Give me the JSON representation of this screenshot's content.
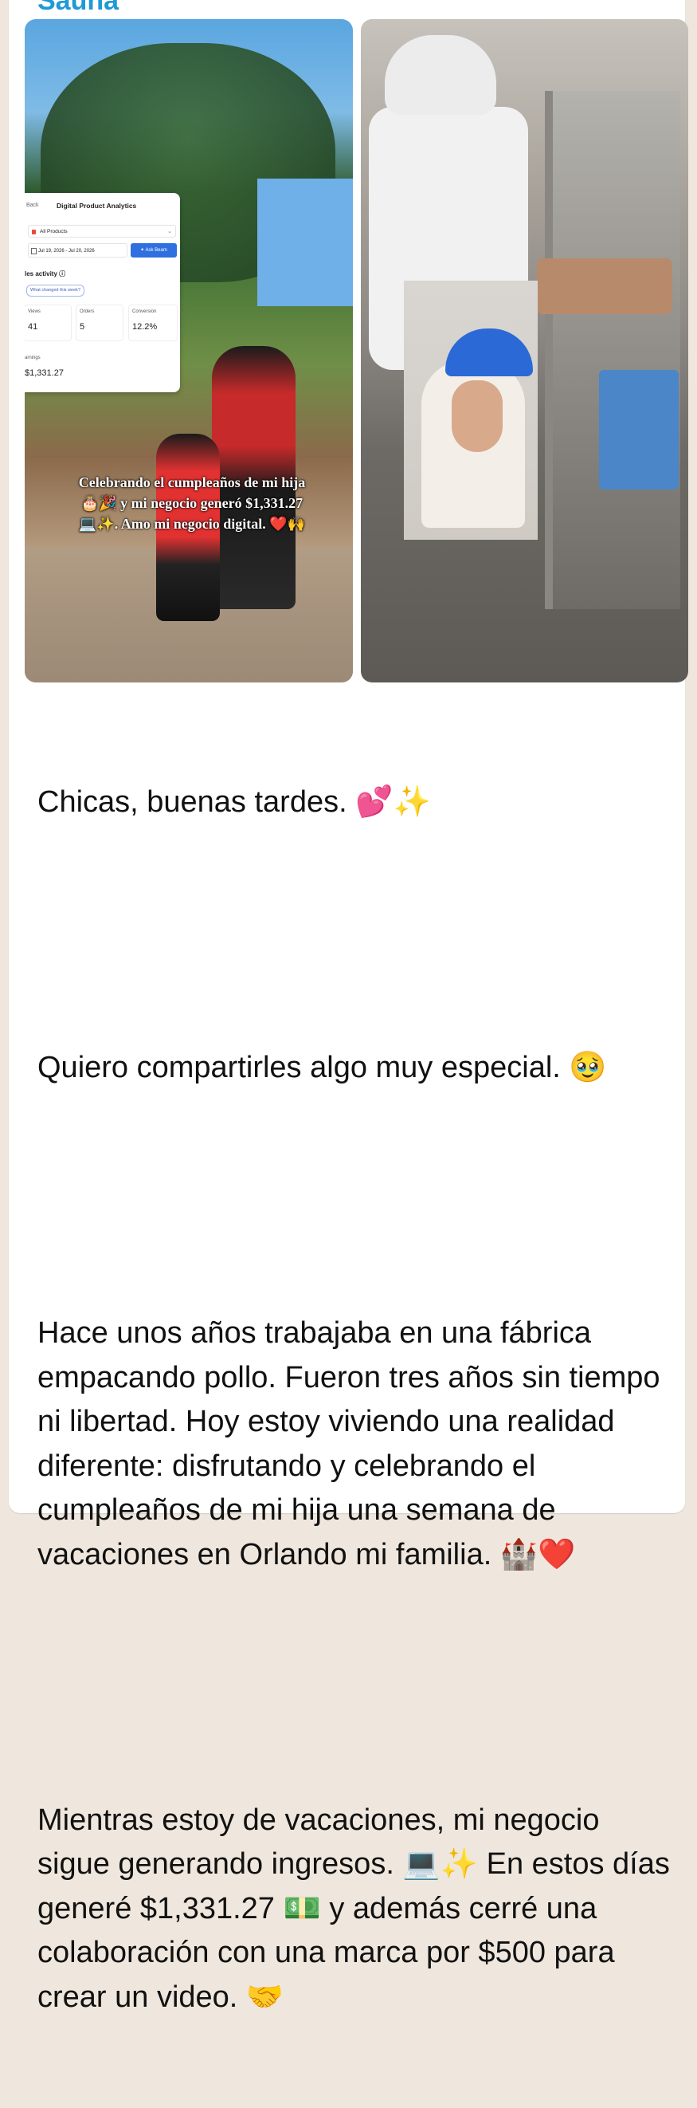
{
  "sender_name": "Sauna",
  "left_image": {
    "analytics_card": {
      "back": "Back",
      "title": "Digital Product Analytics",
      "products_filter": "All Products",
      "date_range": "Jul 19, 2026 - Jul 20, 2026",
      "ask_button": "✦ Ask Beam",
      "activity_heading": "les activity ⓘ",
      "activity_chip": "What changed this week?",
      "metrics": [
        {
          "label": "Views",
          "value": "41"
        },
        {
          "label": "Orders",
          "value": "5"
        },
        {
          "label": "Conversion",
          "value": "12.2%"
        }
      ],
      "earnings_label": "arnings",
      "earnings_value": "$1,331.27"
    },
    "caption": "Celebrando el cumpleaños de mi hija 🎂🎉 y mi negocio generó $1,331.27 💻✨. Amo mi negocio digital. ❤️🙌"
  },
  "message_paragraphs": [
    "Chicas, buenas tardes. 💕✨",
    "Quiero compartirles algo muy especial. 🥹",
    "Hace unos años trabajaba en una fábrica empacando pollo. Fueron tres años sin tiempo ni libertad. Hoy estoy viviendo una realidad diferente: disfrutando y celebrando el cumpleaños de mi hija una semana de vacaciones en Orlando mi familia. 🏰❤️",
    "Mientras estoy de vacaciones, mi negocio sigue generando ingresos. 💻✨ En estos días generé $1,331.27 💵 y además cerré una colaboración con una marca por $500 para crear un video. 🤝"
  ]
}
